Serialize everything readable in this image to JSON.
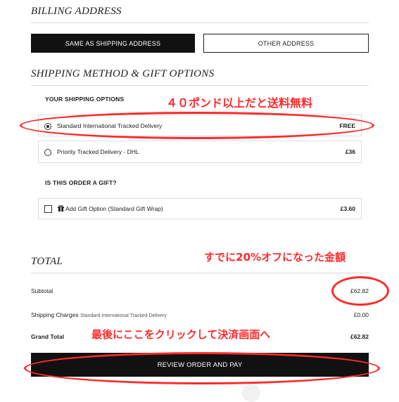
{
  "billing": {
    "title": "BILLING ADDRESS",
    "same_as_shipping_label": "SAME AS SHIPPING ADDRESS",
    "other_address_label": "OTHER ADDRESS"
  },
  "shipping": {
    "title": "SHIPPING METHOD & GIFT OPTIONS",
    "options_label": "YOUR SHIPPING OPTIONS",
    "options": [
      {
        "label": "Standard International Tracked Delivery",
        "price": "FREE",
        "selected": true
      },
      {
        "label": "Priority Tracked Delivery - DHL",
        "price": "£36",
        "selected": false
      }
    ],
    "gift_question": "IS THIS ORDER A GIFT?",
    "gift_option": {
      "icon": "gift-icon",
      "label": "Add Gift Option (Standard Gift Wrap)",
      "price": "£3.60",
      "checked": false
    }
  },
  "total": {
    "title": "TOTAL",
    "subtotal_label": "Subtotal",
    "subtotal_value": "£62.82",
    "shipping_charges_label": "Shipping Charges",
    "shipping_method_note": "Standard International Tracked Delivery",
    "shipping_charges_value": "£0.00",
    "grand_total_label": "Grand Total",
    "grand_total_value": "£62.82",
    "review_button_label": "REVIEW ORDER AND PAY"
  },
  "annotations": {
    "free_shipping_note": "４０ポンド以上だと送料無料",
    "discount_note": "すでに20%オフになった金額",
    "checkout_note": "最後にここをクリックして決済画面へ",
    "color": "#ff2a2a"
  }
}
